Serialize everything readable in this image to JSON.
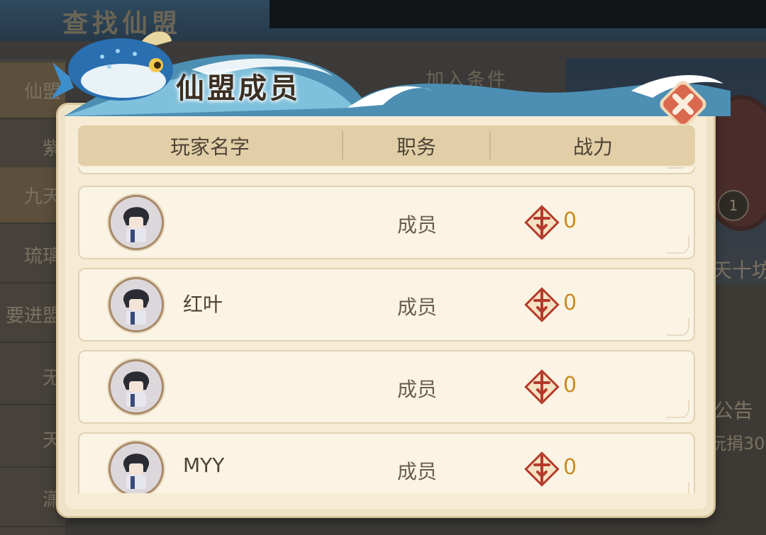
{
  "background": {
    "page_title": "查找仙盟",
    "sidebar_items": [
      "仙盟",
      "紫",
      "九天",
      "琉璃",
      "要进盟",
      "无",
      "天",
      "潇"
    ],
    "join_condition_label": "加入条件",
    "right_panel_name": "天十坊",
    "right_panel_badge": "1",
    "announcement_label": "公告",
    "announcement_text": "玩捐30"
  },
  "modal": {
    "title": "仙盟成员",
    "columns": {
      "name": "玩家名字",
      "role": "职务",
      "power": "战力"
    },
    "members": [
      {
        "name": "",
        "role": "成员",
        "power": "0"
      },
      {
        "name": "红叶",
        "role": "成员",
        "power": "0"
      },
      {
        "name": "",
        "role": "成员",
        "power": "0"
      },
      {
        "name": "MYY",
        "role": "成员",
        "power": "0"
      }
    ],
    "icons": {
      "close": "close-icon",
      "power": "combat-power-icon",
      "avatar": "player-avatar-icon"
    },
    "colors": {
      "power_value": "#c98c26",
      "close_button": "#d9684f",
      "panel_bg": "#f6ecd6"
    }
  }
}
